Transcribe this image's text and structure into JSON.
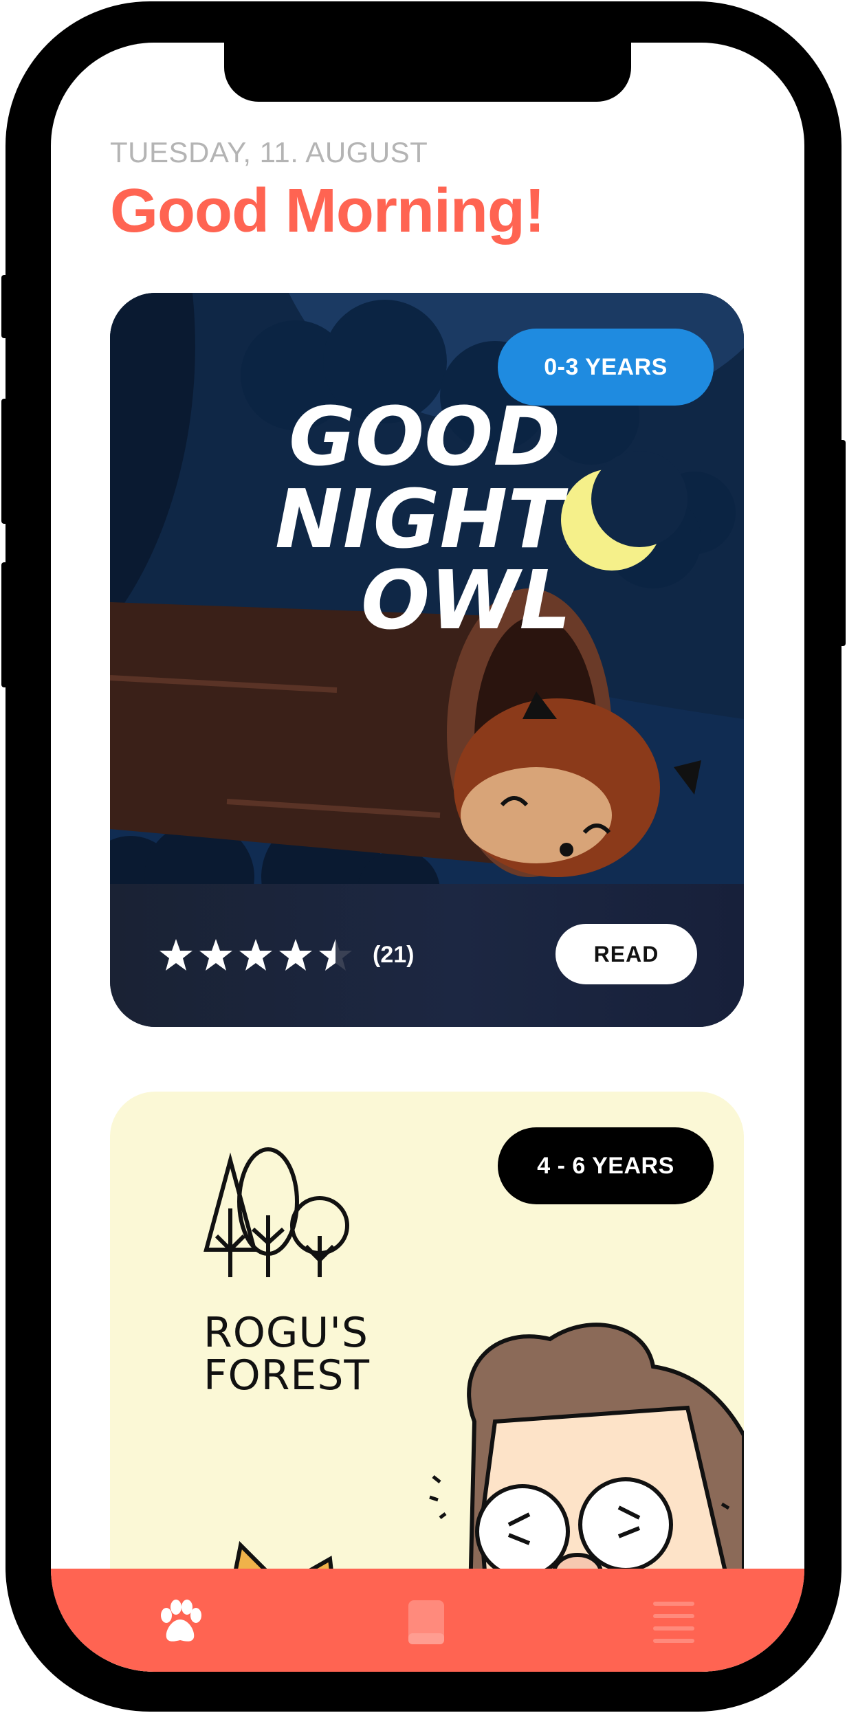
{
  "header": {
    "date": "TUESDAY, 11. AUGUST",
    "greeting": "Good Morning!"
  },
  "books": [
    {
      "title_lines": [
        "GOOD",
        "NIGHT",
        "OWL"
      ],
      "age_badge": "0-3 YEARS",
      "rating": 4.5,
      "rating_count": "(21)",
      "read_label": "READ"
    },
    {
      "title_lines": [
        "ROGU'S",
        "FOREST"
      ],
      "age_badge": "4 - 6 YEARS"
    }
  ],
  "tabbar": {
    "items": [
      {
        "icon": "paw-icon",
        "active": true
      },
      {
        "icon": "book-icon",
        "active": false
      },
      {
        "icon": "menu-icon",
        "active": false
      }
    ]
  },
  "colors": {
    "accent": "#ff6452",
    "badge_blue": "#1f8be0",
    "card2_bg": "#fbf8d6"
  }
}
